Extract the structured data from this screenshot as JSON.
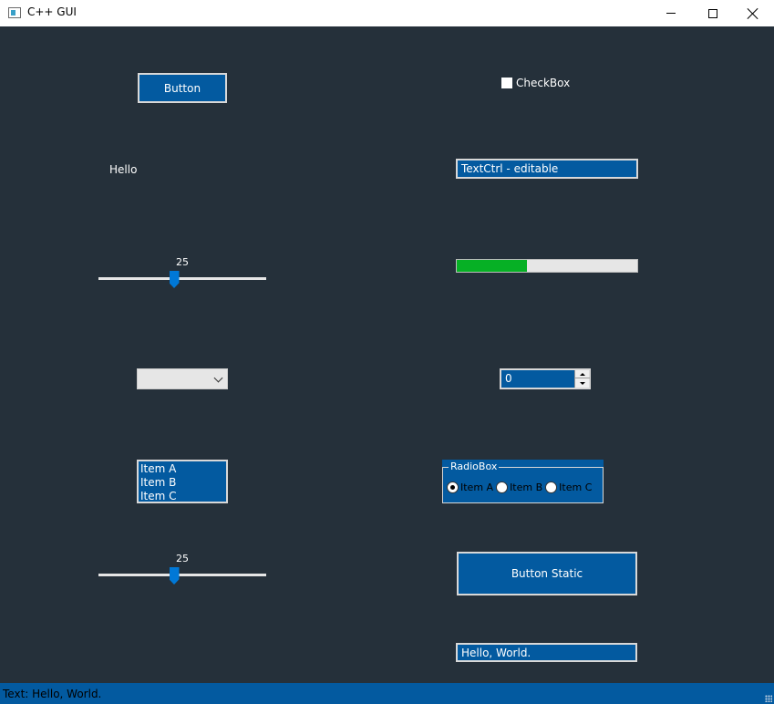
{
  "window": {
    "title": "C++ GUI"
  },
  "controls": {
    "button_label": "Button",
    "checkbox_label": "CheckBox",
    "checkbox_checked": false,
    "static_label": "Hello",
    "textctrl_value": "TextCtrl - editable",
    "gauge_fraction": 0.39,
    "slider1": {
      "value": "25",
      "min": 0,
      "max": 100
    },
    "slider2": {
      "value": "25",
      "min": 0,
      "max": 100
    },
    "combo_value": "",
    "spin_value": "0",
    "listbox_items": [
      "Item A",
      "Item B",
      "Item C"
    ],
    "radiobox": {
      "title": "RadioBox",
      "items": [
        "Item A",
        "Item B",
        "Item C"
      ],
      "selected_index": 0
    },
    "button_static_label": "Button Static",
    "text_output": "Hello, World."
  },
  "statusbar": {
    "text": "Text: Hello, World."
  },
  "colors": {
    "background": "#25303a",
    "control_blue": "#035aa0",
    "gauge_green": "#06b025",
    "slider_thumb": "#0078d7"
  },
  "icons": {
    "app": "app-window-icon",
    "minimize": "minimize-icon",
    "maximize": "maximize-icon",
    "close": "close-icon",
    "combo_arrow": "chevron-down-icon",
    "resize_grip": "resize-grip-icon"
  }
}
